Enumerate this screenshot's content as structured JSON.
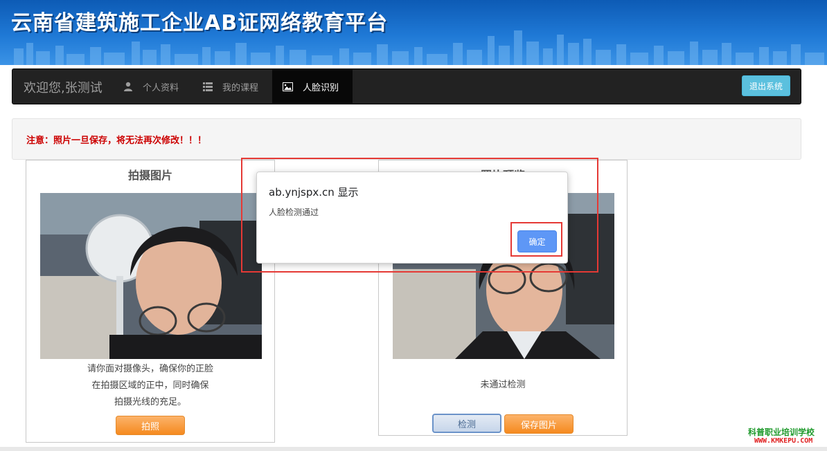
{
  "header": {
    "title": "云南省建筑施工企业AB证网络教育平台"
  },
  "nav": {
    "brand": "欢迎您,张测试",
    "items": [
      {
        "label": "个人资料",
        "icon": "user-icon"
      },
      {
        "label": "我的课程",
        "icon": "list-icon"
      },
      {
        "label": "人脸识别",
        "icon": "image-icon",
        "active": true
      }
    ],
    "logout_label": "退出系统"
  },
  "notice": {
    "text": "注意：照片一旦保存，将无法再次修改！！！",
    "color": "#cc0000"
  },
  "capture_panel": {
    "title": "拍摄图片",
    "instructions": [
      "请你面对摄像头，确保你的正脸",
      "在拍摄区域的正中，同时确保",
      "拍摄光线的充足。"
    ],
    "capture_button": "拍照"
  },
  "preview_panel": {
    "title": "照片预览",
    "status": "未通过检测",
    "detect_button": "检测",
    "save_button": "保存图片"
  },
  "dialog": {
    "origin": "ab.ynjspx.cn 显示",
    "message": "人脸检测通过",
    "ok_label": "确定"
  },
  "watermark": {
    "name": "科普职业培训学校",
    "url": "WWW.KMKEPU.COM"
  },
  "colors": {
    "banner": "#1f79d6",
    "navbar": "#222222",
    "logout": "#5bc0de",
    "orange_button": "#f58a1f",
    "dialog_button": "#5e97f6",
    "annotation": "#e53935"
  }
}
